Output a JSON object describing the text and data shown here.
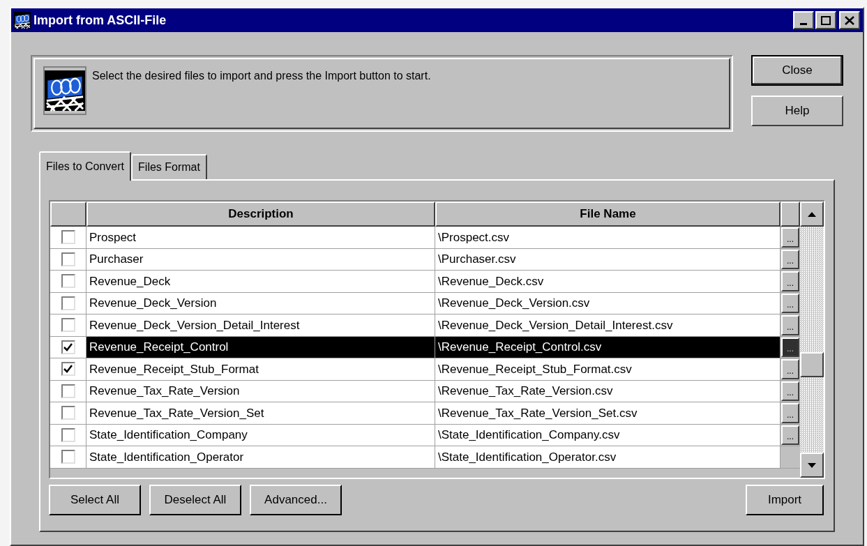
{
  "window": {
    "title": "Import from ASCII-File"
  },
  "info": {
    "message": "Select the desired files to import and press the Import button to start."
  },
  "side_buttons": [
    {
      "label": "Close",
      "default": true
    },
    {
      "label": "Help",
      "default": false
    }
  ],
  "tabs": [
    {
      "label": "Files to Convert",
      "selected": true
    },
    {
      "label": "Files Format",
      "selected": false
    }
  ],
  "table": {
    "columns": [
      "Description",
      "File Name"
    ],
    "rows": [
      {
        "checked": false,
        "selected": false,
        "description": "Prospect",
        "file_name": "\\Prospect.csv",
        "browse": "..."
      },
      {
        "checked": false,
        "selected": false,
        "description": "Purchaser",
        "file_name": "\\Purchaser.csv",
        "browse": "..."
      },
      {
        "checked": false,
        "selected": false,
        "description": "Revenue_Deck",
        "file_name": "\\Revenue_Deck.csv",
        "browse": "..."
      },
      {
        "checked": false,
        "selected": false,
        "description": "Revenue_Deck_Version",
        "file_name": "\\Revenue_Deck_Version.csv",
        "browse": "..."
      },
      {
        "checked": false,
        "selected": false,
        "description": "Revenue_Deck_Version_Detail_Interest",
        "file_name": "\\Revenue_Deck_Version_Detail_Interest.csv",
        "browse": "..."
      },
      {
        "checked": true,
        "selected": true,
        "description": "Revenue_Receipt_Control",
        "file_name": "\\Revenue_Receipt_Control.csv",
        "browse": "..."
      },
      {
        "checked": true,
        "selected": false,
        "description": "Revenue_Receipt_Stub_Format",
        "file_name": "\\Revenue_Receipt_Stub_Format.csv",
        "browse": "..."
      },
      {
        "checked": false,
        "selected": false,
        "description": "Revenue_Tax_Rate_Version",
        "file_name": "\\Revenue_Tax_Rate_Version.csv",
        "browse": "..."
      },
      {
        "checked": false,
        "selected": false,
        "description": "Revenue_Tax_Rate_Version_Set",
        "file_name": "\\Revenue_Tax_Rate_Version_Set.csv",
        "browse": "..."
      },
      {
        "checked": false,
        "selected": false,
        "description": "State_Identification_Company",
        "file_name": "\\State_Identification_Company.csv",
        "browse": "..."
      },
      {
        "checked": false,
        "selected": false,
        "description": "State_Identification_Operator",
        "file_name": "\\State_Identification_Operator.csv"
      }
    ]
  },
  "bottom_buttons": [
    "Select All",
    "Deselect All",
    "Advanced..."
  ],
  "import_button": "Import"
}
